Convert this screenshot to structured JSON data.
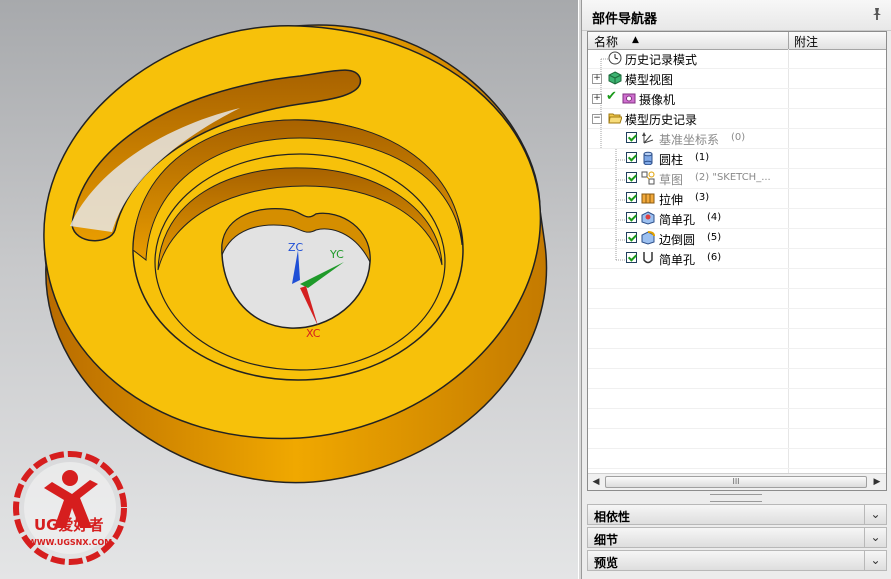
{
  "navigator": {
    "title": "部件导航器",
    "pin_icon": "pin-icon",
    "columns": {
      "name": "名称",
      "note": "附注"
    },
    "rows": [
      {
        "label": "历史记录模式",
        "icon": "clock-icon",
        "muted": false
      },
      {
        "label": "模型视图",
        "icon": "model-views-icon",
        "muted": false
      },
      {
        "label": "摄像机",
        "icon": "camera-icon",
        "muted": false
      },
      {
        "label": "模型历史记录",
        "icon": "folder-open-icon",
        "muted": false
      },
      {
        "label": "基准坐标系",
        "suffix": "(0)",
        "icon": "datum-csys-icon",
        "muted": true
      },
      {
        "label": "圆柱",
        "suffix": "(1)",
        "icon": "cylinder-icon",
        "muted": false
      },
      {
        "label": "草图",
        "suffix": "(2) \"SKETCH_...",
        "icon": "sketch-icon",
        "muted": true
      },
      {
        "label": "拉伸",
        "suffix": "(3)",
        "icon": "extrude-icon",
        "muted": false
      },
      {
        "label": "简单孔",
        "suffix": "(4)",
        "icon": "hole-icon",
        "muted": false
      },
      {
        "label": "边倒圆",
        "suffix": "(5)",
        "icon": "edge-blend-icon",
        "muted": false
      },
      {
        "label": "简单孔",
        "suffix": "(6)",
        "icon": "hole-icon",
        "muted": false
      }
    ],
    "scroll_thumb_label": "III"
  },
  "panels": [
    {
      "label": "相依性"
    },
    {
      "label": "细节"
    },
    {
      "label": "预览"
    }
  ],
  "viewport": {
    "axes": {
      "z": "ZC",
      "y": "YC",
      "x": "XC"
    },
    "watermark": {
      "brand": "UG爱好者",
      "url": "WWW.UGSNX.COM"
    }
  },
  "colors": {
    "part_face": "#f7c10a",
    "part_side": "#d68a00",
    "axis_z": "#1f4fd6",
    "axis_y": "#1f9a2a",
    "axis_x": "#d42020",
    "watermark": "#d61e1e"
  }
}
